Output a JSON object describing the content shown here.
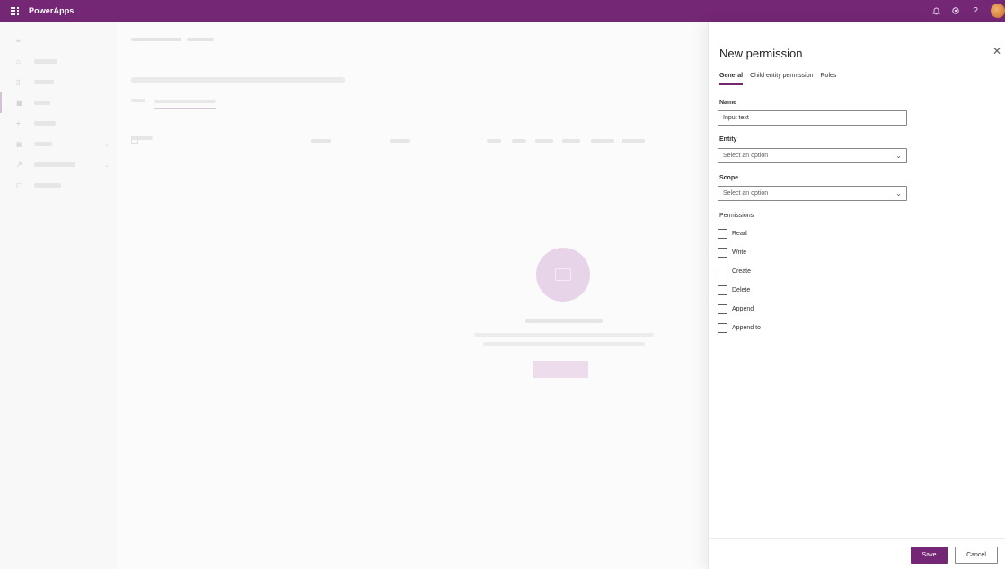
{
  "colors": {
    "brand": "#742774",
    "background": "#fbfbfb",
    "panel": "#ffffff"
  },
  "topbar": {
    "app_title": "PowerApps",
    "icons": [
      "bell-icon",
      "gear-icon",
      "help-icon"
    ]
  },
  "panel": {
    "title": "New permission",
    "tabs": [
      {
        "label": "General",
        "active": true
      },
      {
        "label": "Child entity permission",
        "active": false
      },
      {
        "label": "Roles",
        "active": false
      }
    ],
    "name": {
      "label": "Name",
      "value": "Input text"
    },
    "entity": {
      "label": "Entity",
      "value": "Select an option"
    },
    "scope": {
      "label": "Scope",
      "value": "Select an option"
    },
    "permissions": {
      "label": "Permissions",
      "items": [
        "Read",
        "Write",
        "Create",
        "Delete",
        "Append",
        "Append to"
      ]
    },
    "save_label": "Save",
    "cancel_label": "Cancel"
  }
}
